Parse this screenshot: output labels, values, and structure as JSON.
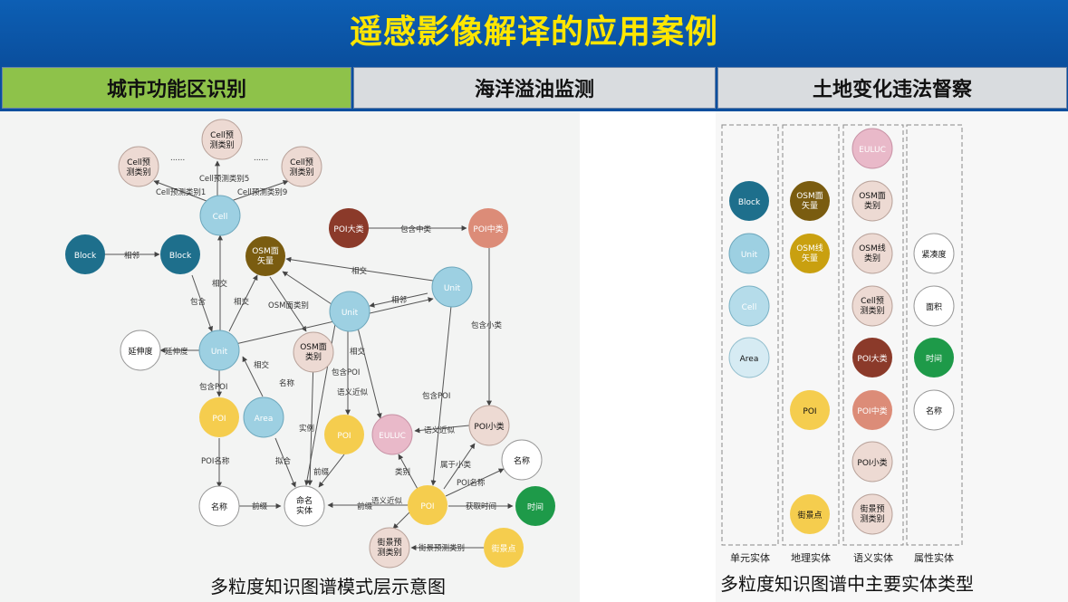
{
  "title": "遥感影像解译的应用案例",
  "tabs": [
    {
      "label": "城市功能区识别",
      "active": true
    },
    {
      "label": "海洋溢油监测",
      "active": false
    },
    {
      "label": "土地变化违法督察",
      "active": false
    }
  ],
  "colors": {
    "cell_pink": "#eddad3",
    "light_blue": "#9dd0e2",
    "dark_teal": "#1e6f8c",
    "olive": "#7a5c10",
    "gold": "#c9a010",
    "yellow": "#f5cd4e",
    "brown_red": "#8b3a2a",
    "salmon": "#dc8c78",
    "euluc_pink": "#e9b9c9",
    "green": "#1e9a49",
    "pale_blue": "#d6ebf3",
    "white": "#ffffff"
  },
  "left_diagram": {
    "caption": "多粒度知识图谱模式层示意图",
    "dots": "......",
    "nodes": [
      {
        "id": "cell_top",
        "label": [
          "Cell预",
          "测类别"
        ]
      },
      {
        "id": "cell_left",
        "label": [
          "Cell预",
          "测类别"
        ]
      },
      {
        "id": "cell_right",
        "label": [
          "Cell预",
          "测类别"
        ]
      },
      {
        "id": "cell",
        "label": [
          "Cell"
        ]
      },
      {
        "id": "block1",
        "label": [
          "Block"
        ]
      },
      {
        "id": "block2",
        "label": [
          "Block"
        ]
      },
      {
        "id": "osm_vec",
        "label": [
          "OSM面",
          "矢量"
        ]
      },
      {
        "id": "poi_big",
        "label": [
          "POI大类"
        ]
      },
      {
        "id": "poi_mid",
        "label": [
          "POI中类"
        ]
      },
      {
        "id": "unit_r",
        "label": [
          "Unit"
        ]
      },
      {
        "id": "unit_m",
        "label": [
          "Unit"
        ]
      },
      {
        "id": "unit_l",
        "label": [
          "Unit"
        ]
      },
      {
        "id": "extend",
        "label": [
          "延伸度"
        ]
      },
      {
        "id": "osm_cat",
        "label": [
          "OSM面",
          "类别"
        ]
      },
      {
        "id": "area",
        "label": [
          "Area"
        ]
      },
      {
        "id": "poi1",
        "label": [
          "POI"
        ]
      },
      {
        "id": "poi2",
        "label": [
          "POI"
        ]
      },
      {
        "id": "euluc",
        "label": [
          "EULUC"
        ]
      },
      {
        "id": "poi_small",
        "label": [
          "POI小类"
        ]
      },
      {
        "id": "name1",
        "label": [
          "名称"
        ]
      },
      {
        "id": "named",
        "label": [
          "命名",
          "实体"
        ]
      },
      {
        "id": "poi3",
        "label": [
          "POI"
        ]
      },
      {
        "id": "name2",
        "label": [
          "名称"
        ]
      },
      {
        "id": "time",
        "label": [
          "时间"
        ]
      },
      {
        "id": "street_cat",
        "label": [
          "街景预",
          "测类别"
        ]
      },
      {
        "id": "street",
        "label": [
          "街景点"
        ]
      }
    ],
    "edge_labels": [
      "Cell预测类别1",
      "Cell预测类别5",
      "Cell预测类别9",
      "相邻",
      "包含中类",
      "相交",
      "相交",
      "包含",
      "相交",
      "OSM面类别",
      "相邻",
      "包含小类",
      "延伸度",
      "相交",
      "包含POI",
      "相交",
      "名称",
      "包含POI",
      "语义近似",
      "包含POI",
      "POI名称",
      "拟合",
      "实例",
      "前缀",
      "语义近似",
      "属于小类",
      "类别",
      "POI名称",
      "前缀",
      "前缀",
      "语义近似",
      "获取时间",
      "街景预测类别"
    ]
  },
  "right_diagram": {
    "caption": "多粒度知识图谱中主要实体类型",
    "columns": [
      {
        "label": "单元实体",
        "nodes": [
          "Block",
          "Unit",
          "Cell",
          "Area"
        ]
      },
      {
        "label": "地理实体",
        "nodes": [
          "OSM面矢量",
          "OSM线矢量",
          "POI",
          "街景点"
        ]
      },
      {
        "label": "语义实体",
        "nodes": [
          "EULUC",
          "OSM面类别",
          "OSM线类别",
          "Cell预测类别",
          "POI大类",
          "POI中类",
          "POI小类",
          "街景预测类别"
        ]
      },
      {
        "label": "属性实体",
        "nodes": [
          "紧凑度",
          "面积",
          "时间",
          "名称"
        ]
      }
    ],
    "node_labels": {
      "osm_area_vec": [
        "OSM面",
        "矢量"
      ],
      "osm_line_vec": [
        "OSM线",
        "矢量"
      ],
      "osm_area_cat": [
        "OSM面",
        "类别"
      ],
      "osm_line_cat": [
        "OSM线",
        "类别"
      ],
      "cell_cat": [
        "Cell预",
        "测类别"
      ],
      "street_cat": [
        "街景预",
        "测类别"
      ]
    }
  }
}
